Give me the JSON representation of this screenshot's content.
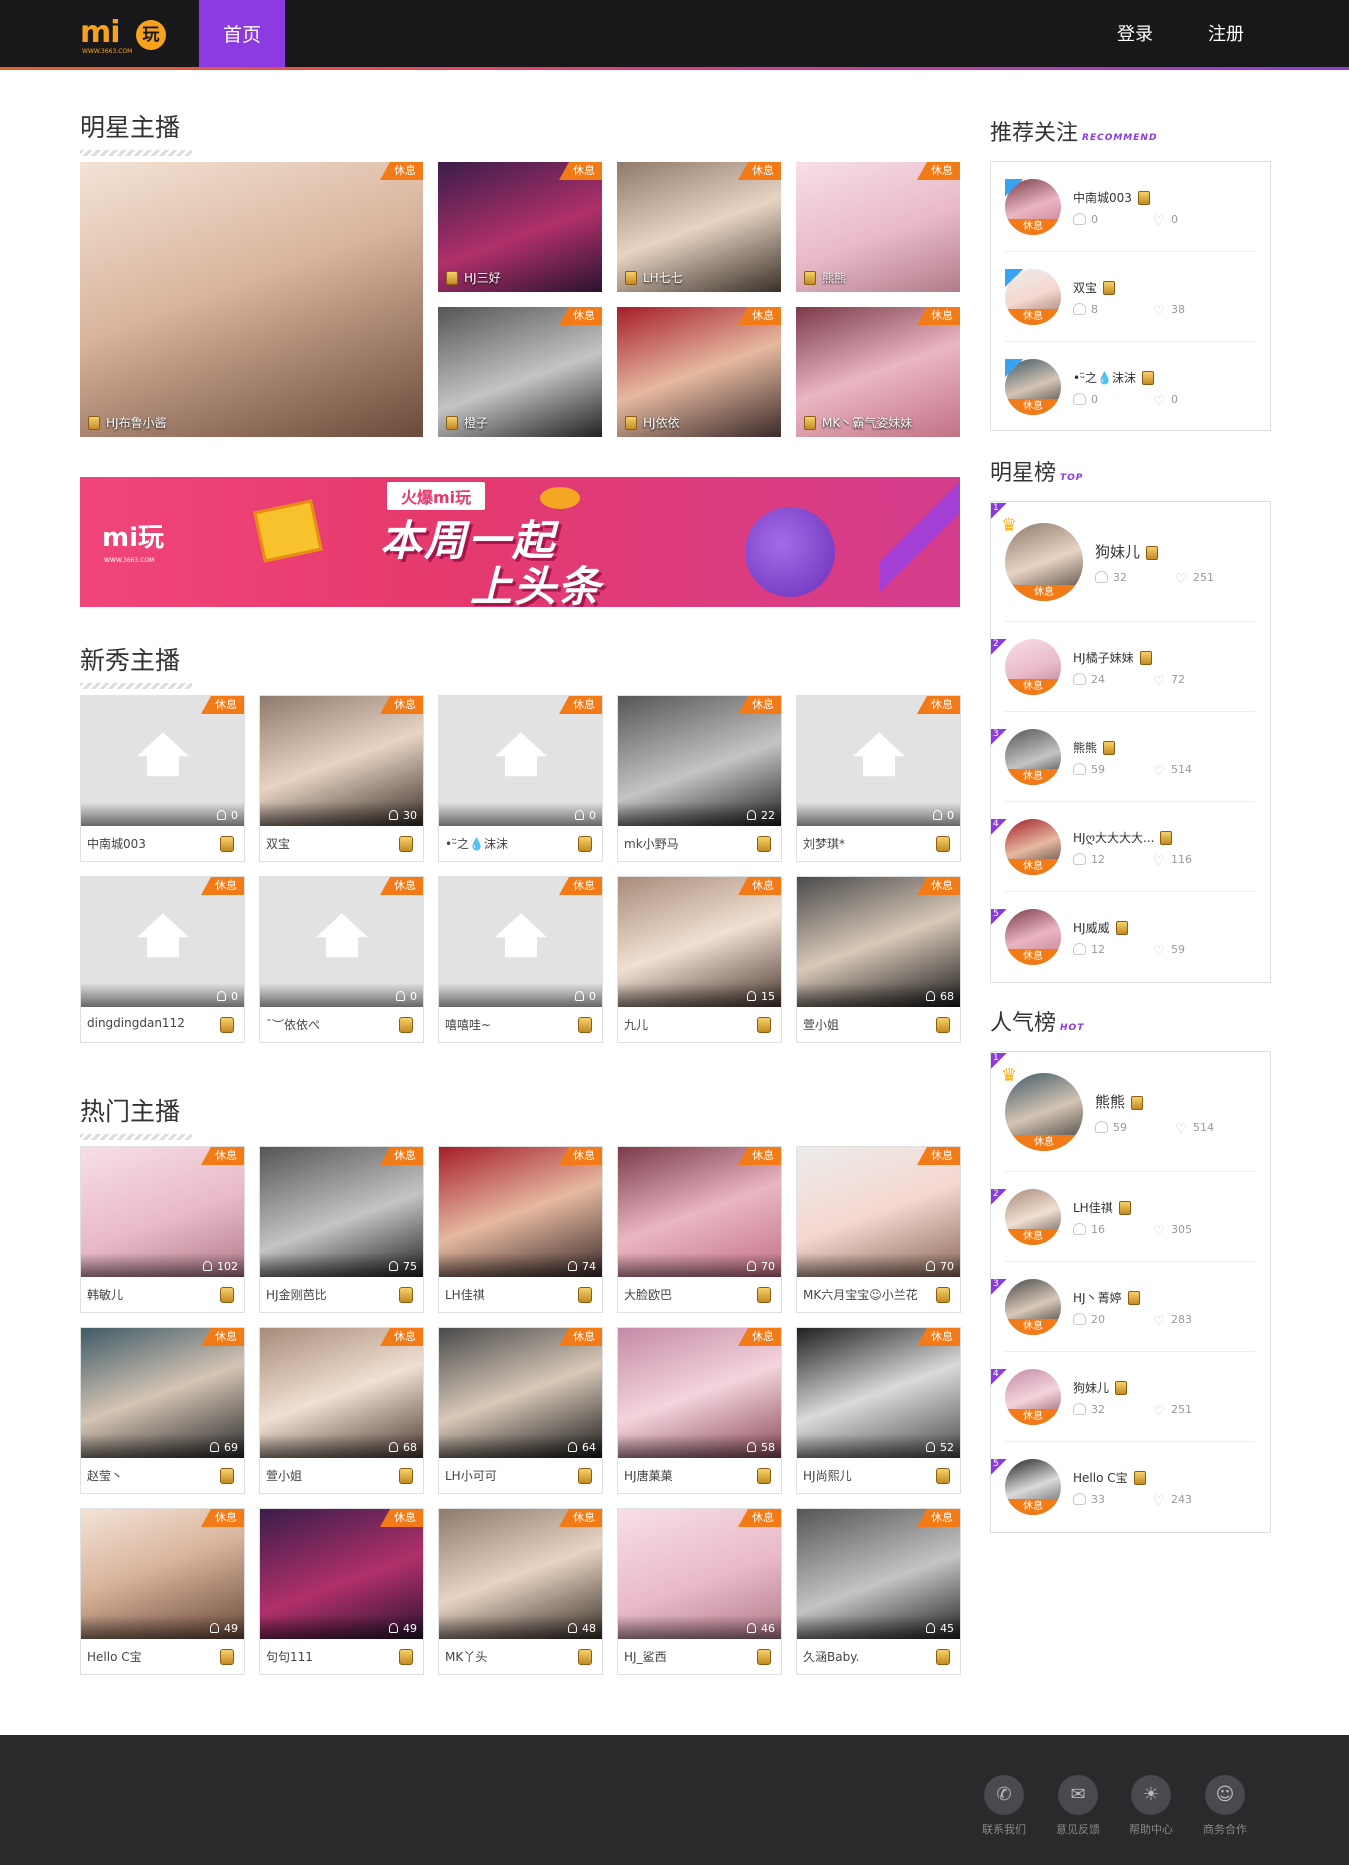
{
  "nav": {
    "logo_text": "mi",
    "logo_wan": "玩",
    "logo_url": "WWW.3663.COM",
    "home": "首页",
    "login": "登录",
    "register": "注册"
  },
  "rest_label": "休息",
  "sections": {
    "star": "明星主播",
    "new": "新秀主播",
    "hot": "热门主播"
  },
  "star_anchors": [
    "HJ布鲁小酱",
    "HJ三好",
    "LH七七",
    "熊熊",
    "橙子",
    "HJ依依",
    "MK丶霸气姿妹妹"
  ],
  "banner": {
    "logo": "mi玩",
    "url": "WWW.3663.COM",
    "top": "火爆mi玩",
    "line1": "本周一起",
    "line2": "上头条"
  },
  "new_anchors": [
    {
      "name": "中南城003",
      "count": "0"
    },
    {
      "name": "双宝",
      "count": "30"
    },
    {
      "name": "•ᵕ̈之💧沫沫",
      "count": "0"
    },
    {
      "name": "mk小野马",
      "count": "22"
    },
    {
      "name": "刘梦琪*",
      "count": "0"
    },
    {
      "name": "dingdingdan112",
      "count": "0"
    },
    {
      "name": "ˉ︶依依ぺ",
      "count": "0"
    },
    {
      "name": "嘻嘻哇~",
      "count": "0"
    },
    {
      "name": "九儿",
      "count": "15"
    },
    {
      "name": "萱小姐",
      "count": "68"
    }
  ],
  "hot_anchors": [
    {
      "name": "韩敏儿",
      "count": "102"
    },
    {
      "name": "HJ金刚芭比",
      "count": "75"
    },
    {
      "name": "LH佳祺",
      "count": "74"
    },
    {
      "name": "大脸欧巴",
      "count": "70"
    },
    {
      "name": "MK六月宝宝☺小兰花",
      "count": "70"
    },
    {
      "name": "赵莹丶",
      "count": "69"
    },
    {
      "name": "萱小姐",
      "count": "68"
    },
    {
      "name": "LH小可可",
      "count": "64"
    },
    {
      "name": "HJ唐菓菓",
      "count": "58"
    },
    {
      "name": "HJ尚熙儿",
      "count": "52"
    },
    {
      "name": "Hello C宝",
      "count": "49"
    },
    {
      "name": "句句111",
      "count": "49"
    },
    {
      "name": "MK丫头",
      "count": "48"
    },
    {
      "name": "HJ_鲨西",
      "count": "46"
    },
    {
      "name": "久涵Baby.",
      "count": "45"
    }
  ],
  "sidebar": {
    "recommend": {
      "title": "推荐关注",
      "tag": "RECOMMEND",
      "items": [
        {
          "name": "中南城003",
          "fans": "0",
          "likes": "0"
        },
        {
          "name": "双宝",
          "fans": "8",
          "likes": "38"
        },
        {
          "name": "•ᵕ̈之💧沫沫",
          "fans": "0",
          "likes": "0"
        }
      ]
    },
    "star_rank": {
      "title": "明星榜",
      "tag": "TOP",
      "items": [
        {
          "rank": "1",
          "name": "狗妹儿",
          "fans": "32",
          "likes": "251"
        },
        {
          "rank": "2",
          "name": "HJ橘子妹妹",
          "fans": "24",
          "likes": "72"
        },
        {
          "rank": "3",
          "name": "熊熊",
          "fans": "59",
          "likes": "514"
        },
        {
          "rank": "4",
          "name": "HJღ大大大大...",
          "fans": "12",
          "likes": "116"
        },
        {
          "rank": "5",
          "name": "HJ威威",
          "fans": "12",
          "likes": "59"
        }
      ]
    },
    "hot_rank": {
      "title": "人气榜",
      "tag": "HOT",
      "items": [
        {
          "rank": "1",
          "name": "熊熊",
          "fans": "59",
          "likes": "514"
        },
        {
          "rank": "2",
          "name": "LH佳祺",
          "fans": "16",
          "likes": "305"
        },
        {
          "rank": "3",
          "name": "HJ丶菁婷",
          "fans": "20",
          "likes": "283"
        },
        {
          "rank": "4",
          "name": "狗妹儿",
          "fans": "32",
          "likes": "251"
        },
        {
          "rank": "5",
          "name": "Hello C宝",
          "fans": "33",
          "likes": "243"
        }
      ]
    }
  },
  "footer": [
    "联系我们",
    "意见反馈",
    "帮助中心",
    "商务合作"
  ],
  "colors": {
    "accent": "#8c3be0",
    "orange": "#f27b17",
    "dark": "#18181b",
    "footer": "#2a292c"
  }
}
